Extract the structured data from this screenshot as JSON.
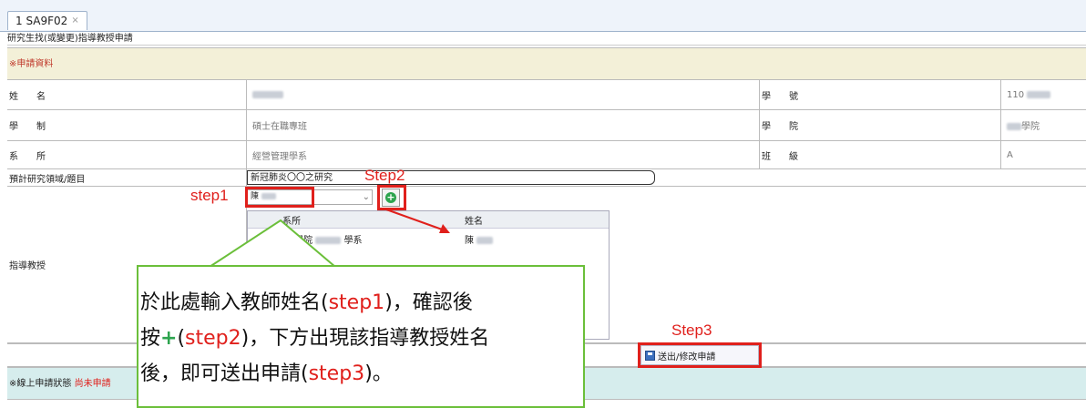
{
  "tab": {
    "label": "1 SA9F02",
    "close": "×"
  },
  "page_title": "研究生找(或變更)指導教授申請",
  "section_header": "※申請資料",
  "fields": {
    "name_label": "姓　　名",
    "student_id_label": "學　　號",
    "student_id_value": "110",
    "program_label": "學　　制",
    "program_value": "碩士在職專班",
    "college_label": "學　　院",
    "college_value": "學院",
    "dept_label": "系　　所",
    "dept_value": "經營管理學系",
    "class_label": "班　　級",
    "class_value": "A",
    "topic_label": "預計研究領域/題目",
    "topic_value": "新冠肺炎〇〇之研究",
    "advisor_label": "指導教授",
    "advisor_input_value": "陳"
  },
  "grid": {
    "headers": [
      "系所",
      "姓名"
    ],
    "rows": [
      {
        "dept_a": "學院",
        "dept_b": "學系",
        "name": "陳"
      }
    ]
  },
  "buttons": {
    "submit": "送出/修改申請",
    "add": "+"
  },
  "status": {
    "label": "※線上申請狀態",
    "value": "尚未申請"
  },
  "annotations": {
    "step1": "step1",
    "step2": "Step2",
    "step3": "Step3"
  },
  "callout": {
    "part1": "於此處輸入教師姓名(",
    "step1": "step1",
    "part2": ")，確認後",
    "part3": "按",
    "plus": "+",
    "part4": "(",
    "step2": "step2",
    "part5": ")，下方出現該指導教授姓名",
    "part6": "後，即可送出申請(",
    "step3": "step3",
    "part7": ")。"
  },
  "colors": {
    "annotation_red": "#e0201c",
    "callout_border": "#6bbf3a",
    "section_bg": "#f3f0d8",
    "status_bg": "#d6eded"
  }
}
